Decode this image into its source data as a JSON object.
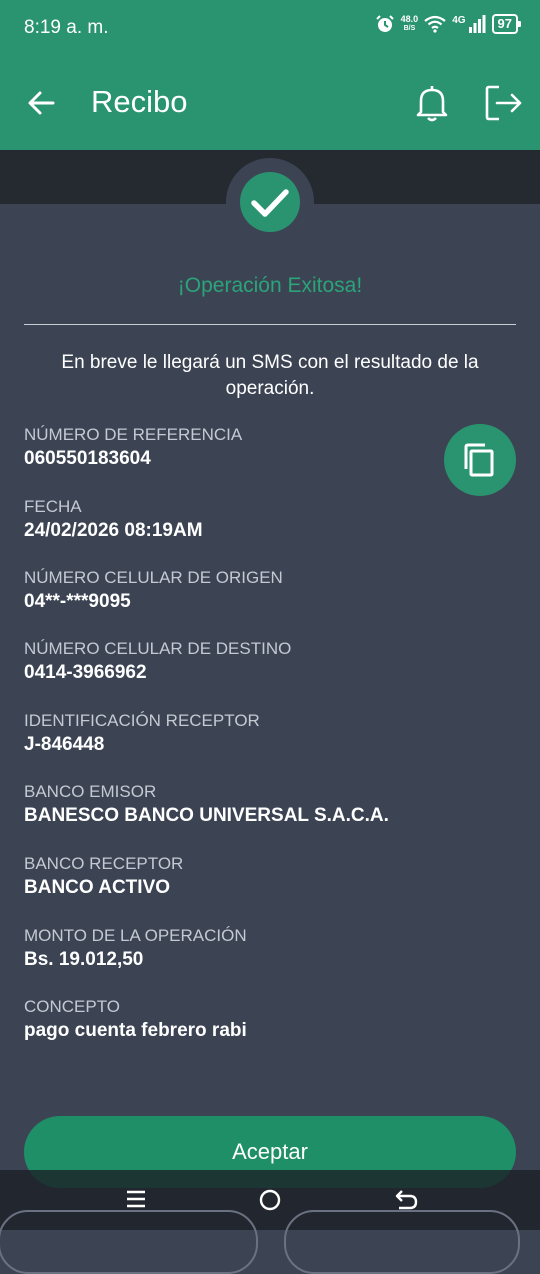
{
  "status_bar": {
    "time": "8:19 a. m.",
    "speed_value": "48.0",
    "speed_unit": "B/S",
    "network": "4G",
    "battery": "97"
  },
  "header": {
    "title": "Recibo"
  },
  "success": {
    "message": "¡Operación Exitosa!",
    "sms_notice": "En breve le llegará un SMS con el resultado de la operación."
  },
  "fields": [
    {
      "label": "NÚMERO DE REFERENCIA",
      "value": "060550183604"
    },
    {
      "label": "FECHA",
      "value": "24/02/2026 08:19AM"
    },
    {
      "label": "NÚMERO CELULAR DE ORIGEN",
      "value": "04**-***9095"
    },
    {
      "label": "NÚMERO CELULAR DE DESTINO",
      "value": "0414-3966962"
    },
    {
      "label": "IDENTIFICACIÓN RECEPTOR",
      "value": "J-846448"
    },
    {
      "label": "BANCO EMISOR",
      "value": "BANESCO BANCO UNIVERSAL S.A.C.A."
    },
    {
      "label": "BANCO RECEPTOR",
      "value": "BANCO ACTIVO"
    },
    {
      "label": "MONTO DE LA OPERACIÓN",
      "value": "Bs. 19.012,50"
    },
    {
      "label": "CONCEPTO",
      "value": "pago cuenta febrero rabi"
    }
  ],
  "actions": {
    "accept_label": "Aceptar"
  },
  "icons": {
    "back": "arrow-back-icon",
    "notifications": "bell-icon",
    "logout": "logout-icon",
    "copy": "copy-icon",
    "success": "check-icon"
  },
  "colors": {
    "primary": "#2a9470",
    "background": "#3c4454",
    "success_text": "#2aa478"
  }
}
